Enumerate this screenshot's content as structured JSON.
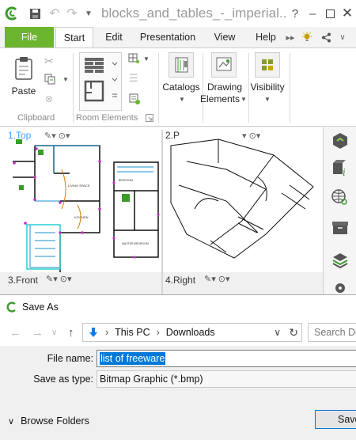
{
  "window": {
    "title": "blocks_and_tables_-_imperial....",
    "help": "?",
    "minimize": "–",
    "close": "✕"
  },
  "ribbon": {
    "tabs": {
      "file": "File",
      "start": "Start",
      "edit": "Edit",
      "presentation": "Presentation",
      "view": "View",
      "help": "Help"
    },
    "clipboard": {
      "paste": "Paste",
      "group": "Clipboard"
    },
    "room_elements": {
      "group": "Room Elements"
    },
    "catalogs": "Catalogs",
    "drawing_elements": [
      "Drawing",
      "Elements"
    ],
    "visibility": "Visibility"
  },
  "viewports": {
    "top": "1.Top",
    "perspective": "2.P",
    "front": "3.Front",
    "right": "4.Right"
  },
  "plan_text": {
    "living": "LIVING SPACE",
    "kitchen": "KITCHEN",
    "bedroom": "BEDROOM",
    "master": "MASTER BEDROOM"
  },
  "save_dialog": {
    "title": "Save As",
    "breadcrumb": [
      "This PC",
      "Downloads"
    ],
    "search_placeholder": "Search Do",
    "file_name_label": "File name:",
    "file_name_value": "list of freeware",
    "save_type_label": "Save as type:",
    "save_type_value": "Bitmap Graphic (*.bmp)",
    "browse_folders": "Browse Folders",
    "save_button": "Save"
  },
  "colors": {
    "accent_green": "#6bb52f",
    "selection_blue": "#0078d7"
  }
}
